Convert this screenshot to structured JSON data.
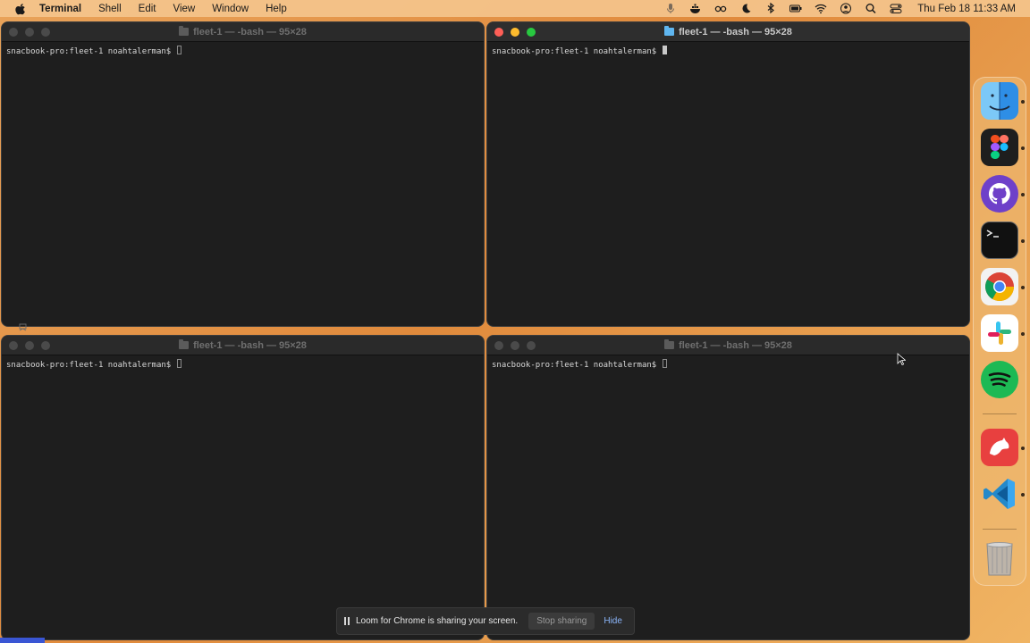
{
  "menubar": {
    "app_name": "Terminal",
    "items": [
      "Shell",
      "Edit",
      "View",
      "Window",
      "Help"
    ],
    "status_icons": [
      "microphone-icon",
      "docker-icon",
      "glasses-icon",
      "moon-icon",
      "bluetooth-icon",
      "battery-icon",
      "wifi-icon",
      "user-icon",
      "search-icon",
      "control-center-icon"
    ],
    "clock": "Thu Feb 18  11:33 AM"
  },
  "windows": [
    {
      "title": "fleet-1 — -bash — 95×28",
      "prompt": "snacbook-pro:fleet-1 noahtalerman$ ",
      "active": false
    },
    {
      "title": "fleet-1 — -bash — 95×28",
      "prompt": "snacbook-pro:fleet-1 noahtalerman$ ",
      "active": true
    },
    {
      "title": "fleet-1 — -bash — 95×28",
      "prompt": "snacbook-pro:fleet-1 noahtalerman$ ",
      "active": false
    },
    {
      "title": "fleet-1 — -bash — 95×28",
      "prompt": "snacbook-pro:fleet-1 noahtalerman$ ",
      "active": false
    }
  ],
  "dock": {
    "apps": [
      "finder-icon",
      "figma-icon",
      "github-desktop-icon",
      "terminal-icon",
      "chrome-icon",
      "slack-icon",
      "spotify-icon",
      "bear-icon",
      "vscode-icon"
    ],
    "trash": "trash-icon"
  },
  "loom": {
    "message": "Loom for Chrome is sharing your screen.",
    "stop_label": "Stop sharing",
    "hide_label": "Hide"
  },
  "colors": {
    "close": "#fe5f57",
    "minimize": "#febc2e",
    "maximize": "#28c840",
    "terminal_bg": "#1e1e1e",
    "link": "#8ab4f8"
  }
}
